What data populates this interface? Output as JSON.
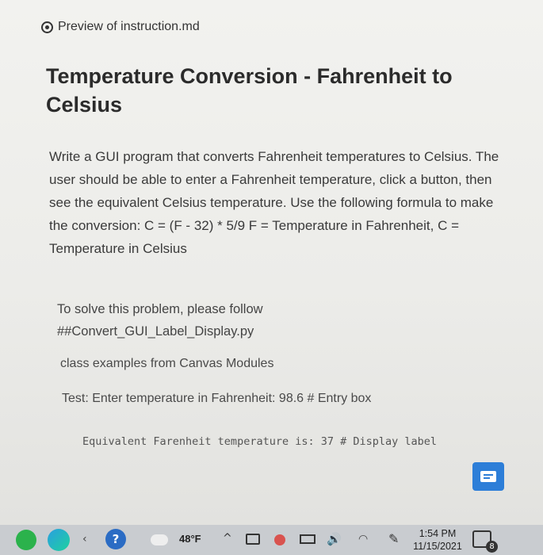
{
  "tab": {
    "title": "Preview of instruction.md",
    "icon": "eye-icon"
  },
  "document": {
    "heading": "Temperature Conversion - Fahrenheit to Celsius",
    "intro": "Write a GUI program that converts Fahrenheit temperatures to Celsius. The user should be able to enter a Fahrenheit temperature, click a button, then see the equivalent Celsius temperature. Use the following formula to make the conversion: C = (F - 32) * 5/9 F = Temperature in Fahrenheit, C = Temperature in Celsius",
    "solve_line1": "To solve this problem, please follow",
    "solve_line2": "##Convert_GUI_Label_Display.py",
    "class_examples": "class examples from Canvas Modules",
    "test_line": "Test: Enter temperature in Fahrenheit: 98.6 # Entry box",
    "code_block": "Equivalent Farenheit temperature is: 37 # Display label"
  },
  "feedback": {
    "icon": "feedback-icon",
    "color": "#2d7ed8"
  },
  "taskbar": {
    "weather": "48°F",
    "time": "1:54 PM",
    "date": "11/15/2021",
    "notification_count": "8",
    "icons": [
      "cortana-icon",
      "edge-icon",
      "chevron-up-icon",
      "help-icon",
      "weather-icon",
      "network-icon",
      "volume-icon",
      "wifi-icon",
      "pen-icon",
      "notification-icon"
    ]
  }
}
